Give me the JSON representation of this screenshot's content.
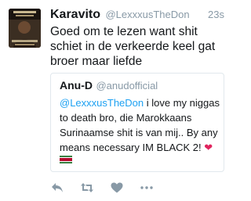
{
  "tweet": {
    "author_name": "Karavito",
    "author_handle": "@LexxxusTheDon",
    "timestamp": "23s",
    "text": "Goed om te lezen want shit schiet in de verkeerde keel gat broer maar liefde",
    "avatar_icon": "profile-photo"
  },
  "quoted_tweet": {
    "author_name": "Anu-D",
    "author_handle": "@anudofficial",
    "mention": "@LexxxusTheDon",
    "text_body": " i love my niggas to death bro, die Marokkaans Surinaamse shit is van mij.. By any means necessary IM BLACK 2! ",
    "emoji_heart": "❤",
    "flag_icon": "suriname-flag-icon"
  },
  "actions": [
    {
      "name": "reply",
      "icon": "reply-icon"
    },
    {
      "name": "retweet",
      "icon": "retweet-icon"
    },
    {
      "name": "like",
      "icon": "heart-icon"
    },
    {
      "name": "more",
      "icon": "more-icon"
    }
  ],
  "colors": {
    "text": "#14171a",
    "muted": "#8899a6",
    "link": "#1da1f2",
    "border": "#e1e8ed",
    "heart": "#e0245e"
  }
}
